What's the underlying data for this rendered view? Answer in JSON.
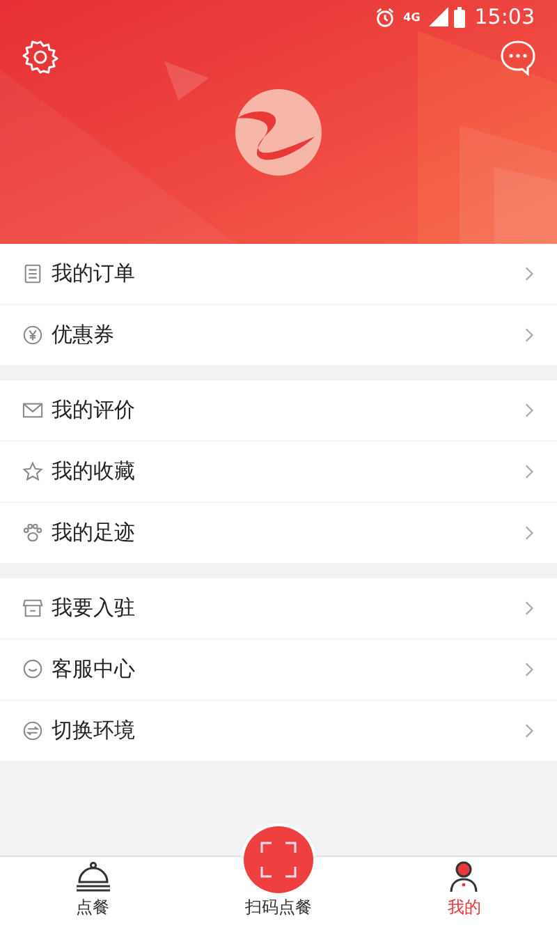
{
  "status_bar": {
    "network": "4G",
    "time": "15:03"
  },
  "menu_groups": [
    {
      "items": [
        {
          "kind": "orders",
          "label": "我的订单"
        },
        {
          "kind": "coupon",
          "label": "优惠券"
        }
      ]
    },
    {
      "items": [
        {
          "kind": "review",
          "label": "我的评价"
        },
        {
          "kind": "favorite",
          "label": "我的收藏"
        },
        {
          "kind": "footprint",
          "label": "我的足迹"
        }
      ]
    },
    {
      "items": [
        {
          "kind": "store",
          "label": "我要入驻"
        },
        {
          "kind": "service",
          "label": "客服中心"
        },
        {
          "kind": "switch",
          "label": "切换环境"
        }
      ]
    }
  ],
  "tab_bar": [
    {
      "kind": "order",
      "label": "点餐",
      "selected": false
    },
    {
      "kind": "scan",
      "label": "扫码点餐",
      "selected": false
    },
    {
      "kind": "me",
      "label": "我的",
      "selected": true
    }
  ]
}
